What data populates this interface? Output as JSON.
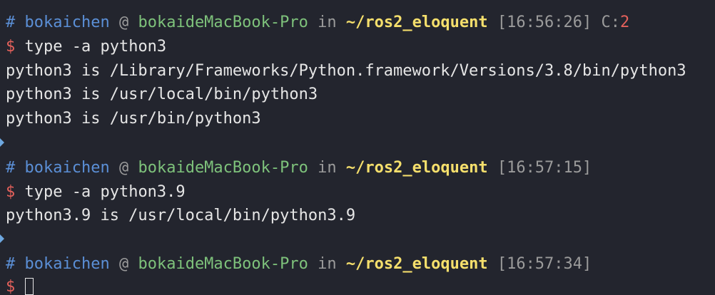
{
  "colors": {
    "background": "#23252e",
    "prompt_user": "#5b8fd6",
    "prompt_host": "#7ec27b",
    "prompt_dir": "#f5df6c",
    "prompt_muted": "#9b9b9b",
    "prompt_dollar": "#e5615b",
    "text": "#e6e6e6"
  },
  "blocks": [
    {
      "prompt": {
        "hash": "#",
        "user": "bokaichen",
        "at": "@",
        "host": "bokaideMacBook-Pro",
        "in": "in",
        "dir": "~/ros2_eloquent",
        "time": "[16:56:26]",
        "code_label": "C:",
        "code_value": "2"
      },
      "dollar": "$",
      "command": "type -a python3",
      "output": [
        "python3 is /Library/Frameworks/Python.framework/Versions/3.8/bin/python3",
        "python3 is /usr/local/bin/python3",
        "python3 is /usr/bin/python3"
      ]
    },
    {
      "prompt": {
        "hash": "#",
        "user": "bokaichen",
        "at": "@",
        "host": "bokaideMacBook-Pro",
        "in": "in",
        "dir": "~/ros2_eloquent",
        "time": "[16:57:15]"
      },
      "dollar": "$",
      "command": "type -a python3.9",
      "output": [
        "python3.9 is /usr/local/bin/python3.9"
      ]
    },
    {
      "prompt": {
        "hash": "#",
        "user": "bokaichen",
        "at": "@",
        "host": "bokaideMacBook-Pro",
        "in": "in",
        "dir": "~/ros2_eloquent",
        "time": "[16:57:34]"
      },
      "dollar": "$",
      "command": ""
    }
  ]
}
